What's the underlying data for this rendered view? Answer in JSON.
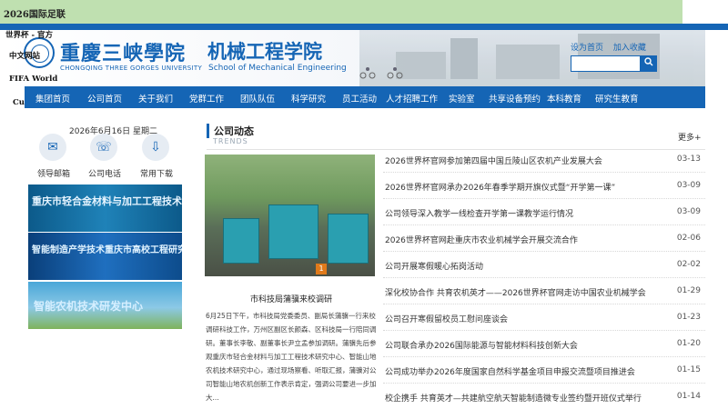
{
  "top_bar": {
    "text": "2026国际足联"
  },
  "overlay_links": [
    "世界杯 - 官方",
    "中文网站",
    "FIFA World",
    "Cu"
  ],
  "header": {
    "college_name_cn": "重慶三峡學院",
    "college_name_en": "CHONGQING THREE GORGES UNIVERSITY",
    "school_name_cn": "机械工程学院",
    "school_name_en": "School of Mechanical Engineering",
    "links": [
      "设为首页",
      "加入收藏"
    ],
    "search_placeholder": ""
  },
  "nav": {
    "items": [
      "集团首页",
      "公司首页",
      "关于我们",
      "党群工作",
      "团队队伍",
      "科学研究",
      "员工活动",
      "人才招聘工作",
      "实验室",
      "共享设备预约",
      "本科教育",
      "研究生教育"
    ]
  },
  "sidebar": {
    "date": "2026年6月16日 星期二",
    "quick_links": [
      {
        "label": "领导邮箱",
        "icon": "mail-icon"
      },
      {
        "label": "公司电话",
        "icon": "phone-icon"
      },
      {
        "label": "常用下载",
        "icon": "download-icon"
      }
    ],
    "banners": [
      "重庆市轻合金材料与加工工程技术研究中心",
      "智能制造产学技术重庆市高校工程研究中心",
      "智能农机技术研发中心"
    ]
  },
  "news": {
    "title": "公司动态",
    "subtitle": "TRENDS",
    "more": "更多+",
    "featured": {
      "badge": "1",
      "title": "市科技局蒲骥来校调研",
      "desc": "6月25日下午，市科技局党委委员、副局长蒲骥一行来校调研科技工作，万州区副区长颜森、区科技局一行陪同调研。董事长李敬、副董事长尹立孟参加调研。蒲骥先后参观重庆市轻合金材料与加工工程技术研究中心、智能山地农机技术研究中心，通过现场察看、听取汇报，蒲骥对公司智能山地农机创新工作表示肯定，强调公司要进一步加大..."
    },
    "items": [
      {
        "title": "2026世界杯官网参加第四届中国丘陵山区农机产业发展大会",
        "date": "03-13"
      },
      {
        "title": "2026世界杯官网承办2026年春季学期开旗仪式暨“开学第一课”",
        "date": "03-09"
      },
      {
        "title": "公司领导深入教学一线检查开学第一课教学运行情况",
        "date": "03-09"
      },
      {
        "title": "2026世界杯官网赴重庆市农业机械学会开展交流合作",
        "date": "02-06"
      },
      {
        "title": "公司开展寒假暖心拓岗活动",
        "date": "02-02"
      },
      {
        "title": "深化校协合作 共育农机英才——2026世界杯官网走访中国农业机械学会",
        "date": "01-29"
      },
      {
        "title": "公司召开寒假留校员工慰问座谈会",
        "date": "01-23"
      },
      {
        "title": "公司联合承办2026国际能源与智能材料科技创新大会",
        "date": "01-20"
      },
      {
        "title": "公司成功举办2026年度国家自然科学基金项目申报交流暨项目推进会",
        "date": "01-15"
      },
      {
        "title": "校企携手 共育英才—共建航空航天智能制造微专业签约暨开班仪式举行",
        "date": "01-14"
      }
    ]
  },
  "colors": {
    "brand": "#1565b5",
    "top_bar": "#bfe0b0",
    "badge": "#e07a1b"
  }
}
